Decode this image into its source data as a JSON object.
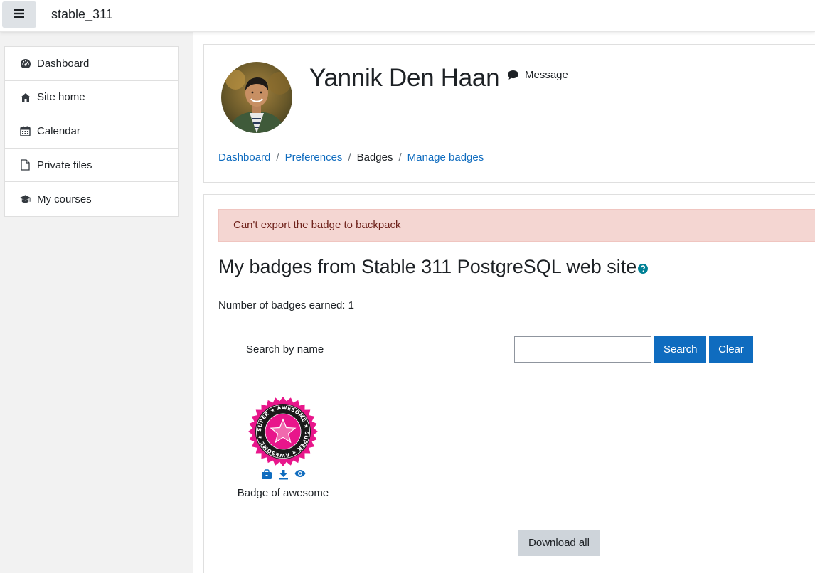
{
  "navbar": {
    "site_name": "stable_311",
    "toggle_icon": "hamburger-icon"
  },
  "drawer": {
    "items": [
      {
        "label": "Dashboard",
        "icon": "dashboard-icon"
      },
      {
        "label": "Site home",
        "icon": "home-icon"
      },
      {
        "label": "Calendar",
        "icon": "calendar-icon"
      },
      {
        "label": "Private files",
        "icon": "file-icon"
      },
      {
        "label": "My courses",
        "icon": "graduation-cap-icon"
      }
    ]
  },
  "header": {
    "fullname": "Yannik Den Haan",
    "message_label": "Message",
    "breadcrumb": [
      {
        "label": "Dashboard",
        "link": true
      },
      {
        "label": "Preferences",
        "link": true
      },
      {
        "label": "Badges",
        "link": false
      },
      {
        "label": "Manage badges",
        "link": true
      }
    ]
  },
  "main": {
    "alert": "Can't export the badge to backpack",
    "title": "My badges from Stable 311 PostgreSQL web site",
    "count_text": "Number of badges earned: 1",
    "search": {
      "label": "Search by name",
      "value": "",
      "search_label": "Search",
      "clear_label": "Clear"
    },
    "badges": [
      {
        "name": "Badge of awesome",
        "ring_text": "SUPER ★ AWESOME ★ SUPER ★ AWESOME ★"
      }
    ],
    "download_all_label": "Download all"
  },
  "colors": {
    "link": "#0f6cbf",
    "primary": "#0f6cbf",
    "alert_bg": "#f4d6d2",
    "alert_text": "#6e211a",
    "badge_pink": "#e8168b"
  }
}
